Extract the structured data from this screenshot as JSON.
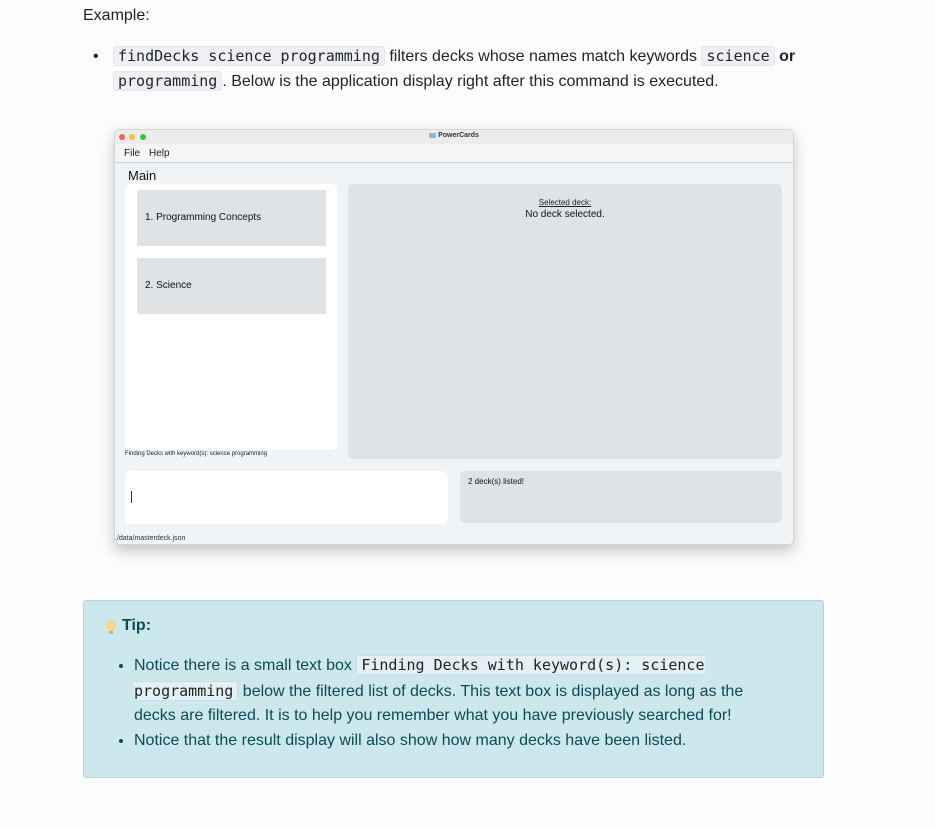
{
  "example_label": "Example:",
  "bullet": {
    "cmd": "findDecks science programming",
    "text_1": "filters decks whose names match keywords",
    "kw_1": "science",
    "or_word": "or",
    "kw_2": "programming",
    "text_2": ". Below is the application display right after this command is executed."
  },
  "app": {
    "window_title": "PowerCards",
    "menu": {
      "file": "File",
      "help": "Help"
    },
    "main_label": "Main",
    "decks": [
      {
        "label": "1.  Programming Concepts"
      },
      {
        "label": "2.  Science"
      }
    ],
    "filter_text": "Finding Decks with keyword(s): science programming",
    "selected_label": "Selected deck:",
    "selected_value": "No deck selected.",
    "result_text": "2 deck(s) listed!",
    "status_path": "./data/masterdeck.json"
  },
  "tip": {
    "title": "Tip:",
    "item_1_pre": "Notice there is a small text box",
    "item_1_code": "Finding Decks with keyword(s): science programming",
    "item_1_post": "below the filtered list of decks. This text box is displayed as long as the decks are filtered. It is to help you remember what you have previously searched for!",
    "item_2": "Notice that the result display will also show how many decks have been listed."
  },
  "colors": {
    "tip_bg": "#cde8ed",
    "deck_card": "#dfe3e6"
  }
}
